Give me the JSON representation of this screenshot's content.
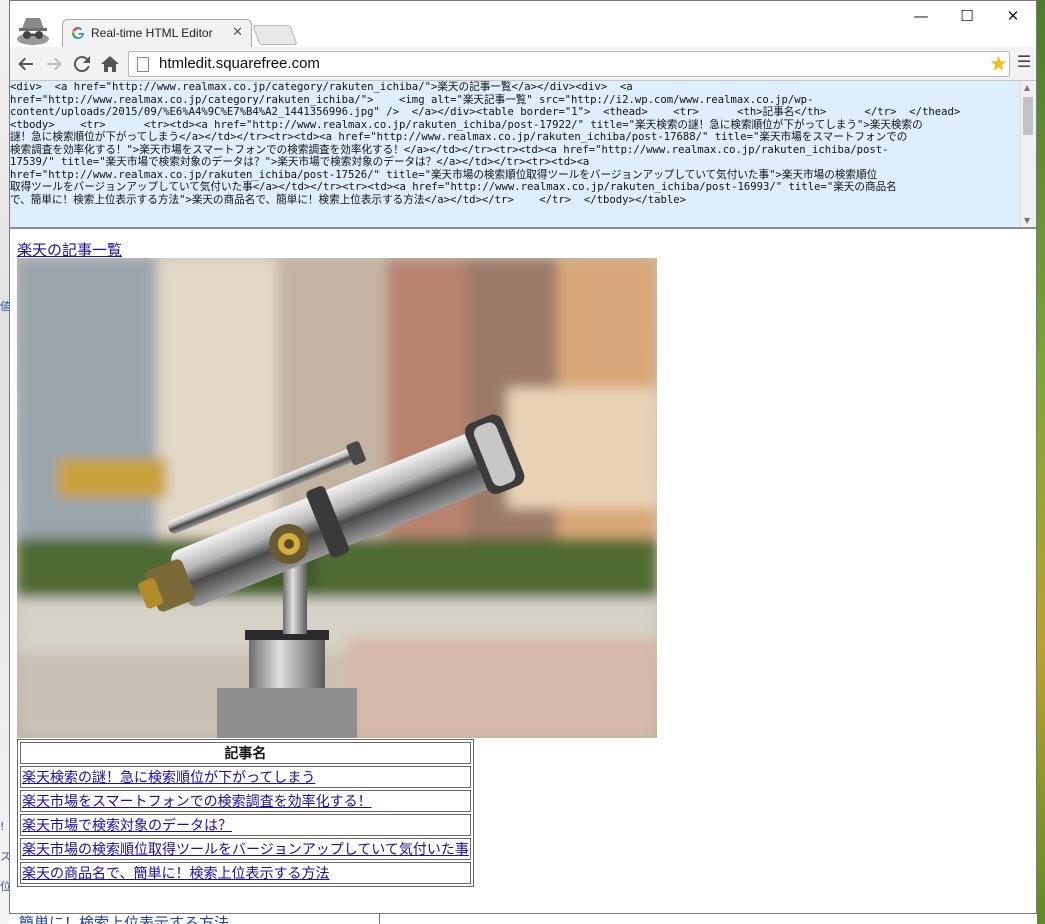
{
  "browser": {
    "tab_title": "Real-time HTML Editor",
    "url": "htmledit.squarefree.com"
  },
  "editor": {
    "source_lines": [
      "<div>  <a href=\"http://www.realmax.co.jp/category/rakuten_ichiba/\">楽天の記事一覧</a></div><div>  <a",
      "href=\"http://www.realmax.co.jp/category/rakuten_ichiba/\">    <img alt=\"楽天記事一覧\" src=\"http://i2.wp.com/www.realmax.co.jp/wp-",
      "content/uploads/2015/09/%E6%A4%9C%E7%B4%A2_1441356996.jpg\" />  </a></div><table border=\"1\">  <thead>    <tr>      <th>記事名</th>      </tr>  </thead>",
      "<tbody>    <tr>      <tr><td><a href=\"http://www.realmax.co.jp/rakuten_ichiba/post-17922/\" title=\"楽天検索の謎！急に検索順位が下がってしまう\">楽天検索の",
      "謎！急に検索順位が下がってしまう</a></td></tr><tr><td><a href=\"http://www.realmax.co.jp/rakuten_ichiba/post-17688/\" title=\"楽天市場をスマートフォンでの",
      "検索調査を効率化する！\">楽天市場をスマートフォンでの検索調査を効率化する！</a></td></tr><tr><td><a href=\"http://www.realmax.co.jp/rakuten_ichiba/post-",
      "17539/\" title=\"楽天市場で検索対象のデータは？\">楽天市場で検索対象のデータは？</a></td></tr><tr><td><a",
      "href=\"http://www.realmax.co.jp/rakuten_ichiba/post-17526/\" title=\"楽天市場の検索順位取得ツールをバージョンアップしていて気付いた事\">楽天市場の検索順位",
      "取得ツールをバージョンアップしていて気付いた事</a></td></tr><tr><td><a href=\"http://www.realmax.co.jp/rakuten_ichiba/post-16993/\" title=\"楽天の商品名",
      "で、簡単に！検索上位表示する方法\">楽天の商品名で、簡単に！検索上位表示する方法</a></td></tr>    </tr>  </tbody></table>"
    ]
  },
  "preview": {
    "top_link": "楽天の記事一覧",
    "table_header": "記事名",
    "rows": [
      "楽天検索の謎！急に検索順位が下がってしまう",
      "楽天市場をスマートフォンでの検索調査を効率化する！",
      "楽天市場で検索対象のデータは？",
      "楽天市場の検索順位取得ツールをバージョンアップしていて気付いた事",
      "楽天の商品名で、簡単に！検索上位表示する方法"
    ]
  },
  "background": {
    "bottom_text": "簡単に！検索上位表示する方法"
  }
}
